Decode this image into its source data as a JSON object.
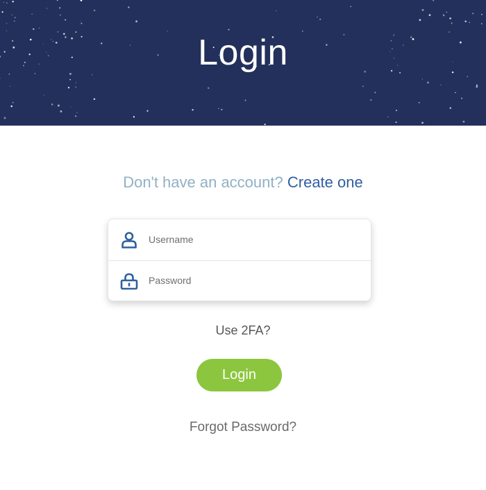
{
  "header": {
    "title": "Login"
  },
  "signup": {
    "prompt": "Don't have an account?",
    "link_label": "Create one"
  },
  "form": {
    "username": {
      "placeholder": "Username",
      "value": "",
      "icon": "user-icon"
    },
    "password": {
      "placeholder": "Password",
      "value": "",
      "icon": "lock-icon"
    }
  },
  "two_factor": {
    "label": "Use 2FA?"
  },
  "login_button": {
    "label": "Login"
  },
  "forgot_password": {
    "label": "Forgot Password?"
  },
  "colors": {
    "header_background": "#22305b",
    "prompt_text": "#8fb1c4",
    "link_text": "#2e5fa1",
    "icon_blue": "#2e5fa1",
    "button_green": "#8cc63f",
    "muted_text": "#555555"
  }
}
